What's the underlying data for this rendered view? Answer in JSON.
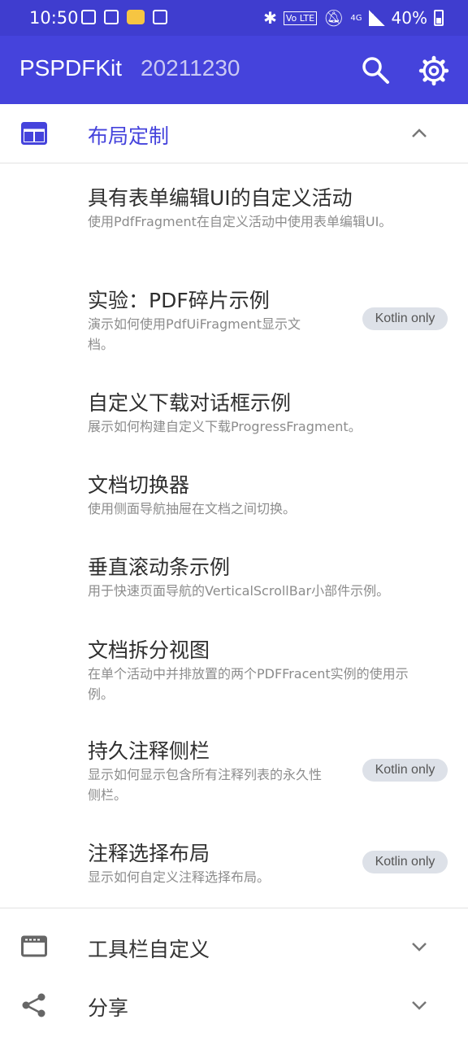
{
  "status_bar": {
    "time": "10:50",
    "battery": "40%",
    "network": "4G"
  },
  "app_bar": {
    "title": "PSPDFKit",
    "version": "20211230"
  },
  "sections": {
    "layout": {
      "label": "布局定制"
    },
    "toolbar": {
      "label": "工具栏自定义"
    },
    "share": {
      "label": "分享"
    }
  },
  "items": [
    {
      "title": "具有表单编辑UI的自定义活动",
      "subtitle": "使用PdfFragment在自定义活动中使用表单编辑UI。"
    },
    {
      "title": "实验：PDF碎片示例",
      "subtitle": "演示如何使用PdfUiFragment显示文档。",
      "badge": "Kotlin only"
    },
    {
      "title": "自定义下载对话框示例",
      "subtitle": "展示如何构建自定义下载ProgressFragment。"
    },
    {
      "title": "文档切换器",
      "subtitle": "使用侧面导航抽屉在文档之间切换。"
    },
    {
      "title": "垂直滚动条示例",
      "subtitle": "用于快速页面导航的VerticalScrollBar小部件示例。"
    },
    {
      "title": "文档拆分视图",
      "subtitle": "在单个活动中并排放置的两个PDFFracent实例的使用示例。"
    },
    {
      "title": "持久注释侧栏",
      "subtitle": "显示如何显示包含所有注释列表的永久性侧栏。",
      "badge": "Kotlin only"
    },
    {
      "title": "注释选择布局",
      "subtitle": "显示如何自定义注释选择布局。",
      "badge": "Kotlin only"
    }
  ]
}
